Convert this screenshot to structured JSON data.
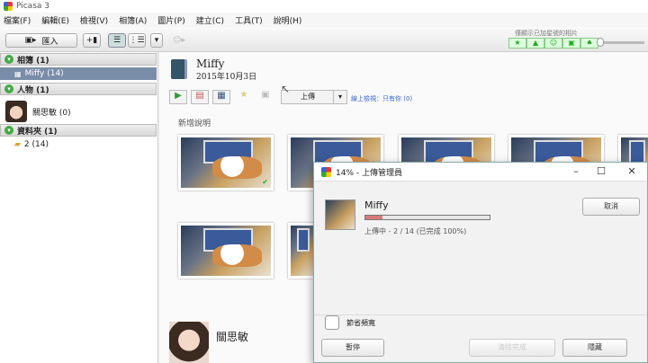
{
  "window": {
    "title": "Picasa 3"
  },
  "menu": [
    "檔案(F)",
    "編輯(E)",
    "檢視(V)",
    "相簿(A)",
    "圖片(P)",
    "建立(C)",
    "工具(T)",
    "說明(H)"
  ],
  "toolbar": {
    "import_label": "匯入",
    "filter_caption": "僅顯示已加星號的相片"
  },
  "sidebar": {
    "albums_header": "相簿 (1)",
    "album_item": "Miffy (14)",
    "people_header": "人物 (1)",
    "person_item": "關思敏 (0)",
    "folders_header": "資料夾 (1)",
    "folder_item": "2 (14)"
  },
  "album": {
    "title": "Miffy",
    "date": "2015年10月3日",
    "upload_label": "上傳",
    "online_label": "線上檢視：只有你",
    "online_count": "(0)",
    "add_description": "新增說明"
  },
  "person_panel": {
    "name": "關思敏"
  },
  "dialog": {
    "title": "14% - 上傳管理員",
    "album_name": "Miffy",
    "status": "上傳中 - 2 / 14 (已完成 100%)",
    "progress_fraction": 0.14,
    "cancel_label": "取消",
    "save_bandwidth_label": "節省頻寬",
    "pause_label": "暫停",
    "clear_label": "清除完成",
    "hide_label": "隱藏"
  },
  "colors": {
    "selected_bg": "#7a8da8",
    "progress": "#d97a7a",
    "accent_green": "#44aa44",
    "link_blue": "#3366cc"
  }
}
